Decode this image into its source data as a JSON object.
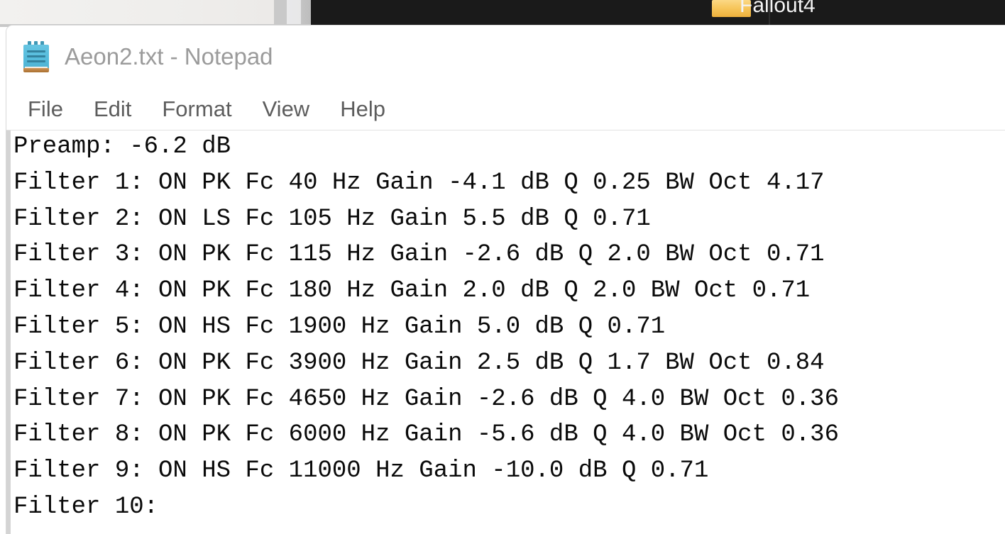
{
  "background": {
    "dark_strip": {
      "folder_icon": "folder-icon",
      "folder_label": "Fallout4",
      "bg_color": "#1a1a1a"
    },
    "edge_glyphs": [
      ")",
      ")"
    ]
  },
  "window": {
    "icon": "notepad-icon",
    "title": "Aeon2.txt - Notepad",
    "title_color": "#9b9b9b"
  },
  "menu": {
    "items": [
      {
        "label": "File"
      },
      {
        "label": "Edit"
      },
      {
        "label": "Format"
      },
      {
        "label": "View"
      },
      {
        "label": "Help"
      }
    ]
  },
  "document": {
    "filename": "Aeon2.txt",
    "preamp_label": "Preamp:",
    "preamp_value": "-6.2 dB",
    "lines": [
      "Preamp: -6.2 dB",
      "Filter 1: ON PK Fc 40 Hz Gain -4.1 dB Q 0.25 BW Oct 4.17",
      "Filter 2: ON LS Fc 105 Hz Gain 5.5 dB Q 0.71",
      "Filter 3: ON PK Fc 115 Hz Gain -2.6 dB Q 2.0 BW Oct 0.71",
      "Filter 4: ON PK Fc 180 Hz Gain 2.0 dB Q 2.0 BW Oct 0.71",
      "Filter 5: ON HS Fc 1900 Hz Gain 5.0 dB Q 0.71",
      "Filter 6: ON PK Fc 3900 Hz Gain 2.5 dB Q 1.7 BW Oct 0.84",
      "Filter 7: ON PK Fc 4650 Hz Gain -2.6 dB Q 4.0 BW Oct 0.36",
      "Filter 8: ON PK Fc 6000 Hz Gain -5.6 dB Q 4.0 BW Oct 0.36",
      "Filter 9: ON HS Fc 11000 Hz Gain -10.0 dB Q 0.71",
      "Filter 10:"
    ],
    "filters": [
      {
        "index": "1",
        "state": "ON",
        "type": "PK",
        "fc": "40",
        "fc_unit": "Hz",
        "gain": "-4.1",
        "gain_unit": "dB",
        "q": "0.25",
        "bw_oct": "4.17"
      },
      {
        "index": "2",
        "state": "ON",
        "type": "LS",
        "fc": "105",
        "fc_unit": "Hz",
        "gain": "5.5",
        "gain_unit": "dB",
        "q": "0.71",
        "bw_oct": ""
      },
      {
        "index": "3",
        "state": "ON",
        "type": "PK",
        "fc": "115",
        "fc_unit": "Hz",
        "gain": "-2.6",
        "gain_unit": "dB",
        "q": "2.0",
        "bw_oct": "0.71"
      },
      {
        "index": "4",
        "state": "ON",
        "type": "PK",
        "fc": "180",
        "fc_unit": "Hz",
        "gain": "2.0",
        "gain_unit": "dB",
        "q": "2.0",
        "bw_oct": "0.71"
      },
      {
        "index": "5",
        "state": "ON",
        "type": "HS",
        "fc": "1900",
        "fc_unit": "Hz",
        "gain": "5.0",
        "gain_unit": "dB",
        "q": "0.71",
        "bw_oct": ""
      },
      {
        "index": "6",
        "state": "ON",
        "type": "PK",
        "fc": "3900",
        "fc_unit": "Hz",
        "gain": "2.5",
        "gain_unit": "dB",
        "q": "1.7",
        "bw_oct": "0.84"
      },
      {
        "index": "7",
        "state": "ON",
        "type": "PK",
        "fc": "4650",
        "fc_unit": "Hz",
        "gain": "-2.6",
        "gain_unit": "dB",
        "q": "4.0",
        "bw_oct": "0.36"
      },
      {
        "index": "8",
        "state": "ON",
        "type": "PK",
        "fc": "6000",
        "fc_unit": "Hz",
        "gain": "-5.6",
        "gain_unit": "dB",
        "q": "4.0",
        "bw_oct": "0.36"
      },
      {
        "index": "9",
        "state": "ON",
        "type": "HS",
        "fc": "11000",
        "fc_unit": "Hz",
        "gain": "-10.0",
        "gain_unit": "dB",
        "q": "0.71",
        "bw_oct": ""
      },
      {
        "index": "10",
        "state": "",
        "type": "",
        "fc": "",
        "fc_unit": "",
        "gain": "",
        "gain_unit": "",
        "q": "",
        "bw_oct": ""
      }
    ]
  }
}
